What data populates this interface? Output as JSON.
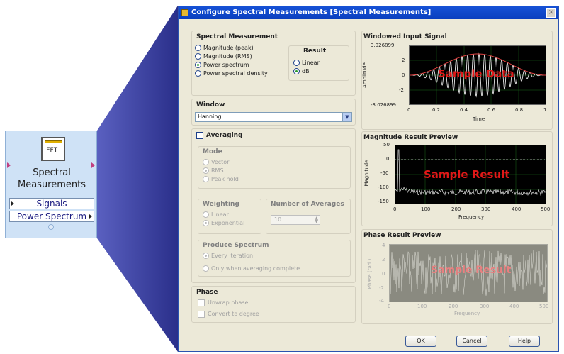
{
  "node": {
    "icon_text": "FFT",
    "title_line1": "Spectral",
    "title_line2": "Measurements",
    "terminal_signals": "Signals",
    "terminal_output": "Power Spectrum"
  },
  "dialog": {
    "title": "Configure Spectral Measurements [Spectral Measurements]",
    "close_glyph": "×",
    "spectral_measurement": {
      "heading": "Spectral Measurement",
      "options": [
        "Magnitude (peak)",
        "Magnitude (RMS)",
        "Power spectrum",
        "Power spectral density"
      ],
      "selected": "Power spectrum"
    },
    "result": {
      "heading": "Result",
      "options": [
        "Linear",
        "dB"
      ],
      "selected": "dB"
    },
    "window": {
      "heading": "Window",
      "value": "Hanning"
    },
    "averaging": {
      "label": "Averaging",
      "mode": {
        "heading": "Mode",
        "options": [
          "Vector",
          "RMS",
          "Peak hold"
        ],
        "selected": "RMS"
      },
      "weighting": {
        "heading": "Weighting",
        "options": [
          "Linear",
          "Exponential"
        ],
        "selected": "Exponential"
      },
      "num_averages": {
        "heading": "Number of Averages",
        "value": "10"
      },
      "produce_spectrum": {
        "heading": "Produce Spectrum",
        "options": [
          "Every iteration",
          "Only when averaging complete"
        ],
        "selected": "Every iteration"
      }
    },
    "phase": {
      "heading": "Phase",
      "options": [
        "Unwrap phase",
        "Convert to degree"
      ]
    },
    "buttons": {
      "ok": "OK",
      "cancel": "Cancel",
      "help": "Help"
    }
  },
  "plots": {
    "windowed": {
      "title": "Windowed Input Signal",
      "ylabel": "Amplitude",
      "xlabel": "Time",
      "overlay": "Sample Data",
      "y_ticks": [
        "3.026899",
        "2",
        "0",
        "-2",
        "-3.026899"
      ],
      "x_ticks": [
        "0",
        "0.2",
        "0.4",
        "0.6",
        "0.8",
        "1"
      ]
    },
    "magnitude": {
      "title": "Magnitude Result Preview",
      "ylabel": "Magnitude",
      "xlabel": "Frequency",
      "overlay": "Sample Result",
      "y_ticks": [
        "50",
        "0",
        "-50",
        "-100",
        "-150"
      ],
      "x_ticks": [
        "0",
        "100",
        "200",
        "300",
        "400",
        "500"
      ]
    },
    "phase": {
      "title": "Phase Result Preview",
      "ylabel": "Phase (rad.)",
      "xlabel": "Frequency",
      "overlay": "Sample Result",
      "y_ticks": [
        "4",
        "2",
        "0",
        "-2",
        "-4"
      ],
      "x_ticks": [
        "0",
        "100",
        "200",
        "300",
        "400",
        "500"
      ]
    }
  },
  "colors": {
    "plot_bg": "#000000",
    "grid": "#1a6a1a",
    "overlay_text": "#e01818",
    "phase_bg": "#8a8a80",
    "callout": "#3a3f9c"
  }
}
